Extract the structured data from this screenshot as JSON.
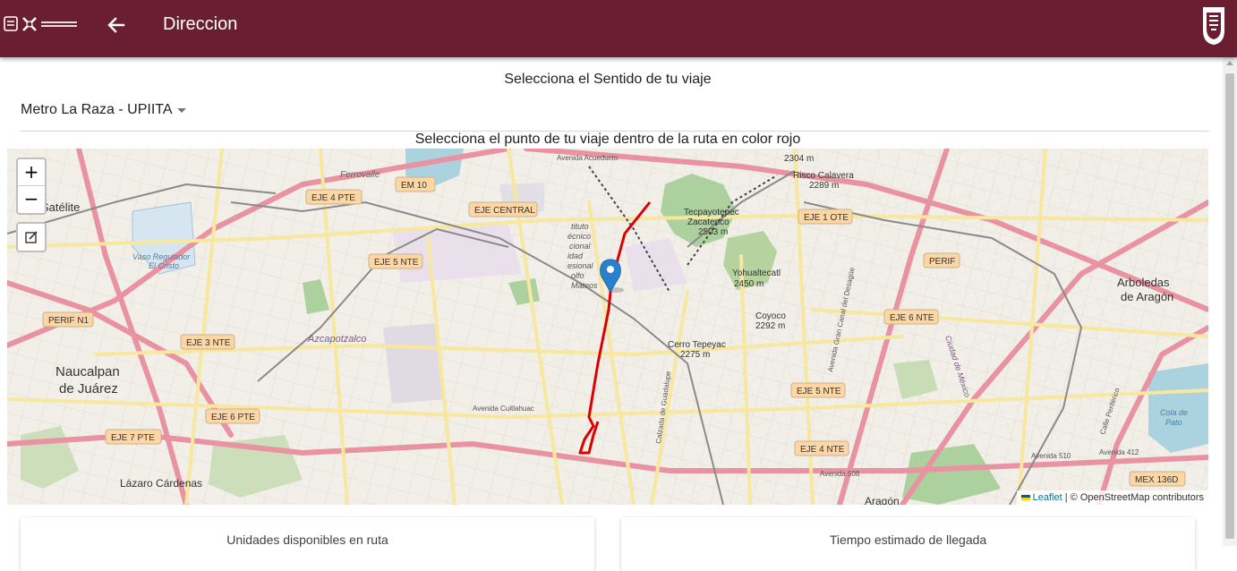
{
  "header": {
    "title": "Direccion",
    "bar_color": "#6b1d31",
    "gov_logo_icon": "gobierno-cdmx-logo",
    "back_icon": "arrow-left-icon",
    "institution_logo_icon": "ipn-logo"
  },
  "direction": {
    "heading": "Selecciona el Sentido de tu viaje",
    "selected": "Metro La Raza - UPIITA"
  },
  "map": {
    "heading": "Selecciona el punto de tu viaje dentro de la ruta en color rojo",
    "zoom_in": "+",
    "zoom_out": "−",
    "attribution": {
      "leaflet": "Leaflet",
      "separator": " | © ",
      "osm": "OpenStreetMap contributors"
    },
    "route_color": "#dd0000",
    "marker_color": "#2a81cb",
    "labels": {
      "satelite": "Satélite",
      "naucalpan1": "Naucalpan",
      "naucalpan2": "de Juárez",
      "lazaro": "Lázaro Cárdenas",
      "arboledas1": "Arboledas",
      "arboledas2": "de Aragón",
      "aragon": "Aragón",
      "azcapotzalco": "Azcapotzalco",
      "tepeyac1": "Tecpayotepec",
      "tepeyac2": "Zacatenco",
      "tepeyac3": "2503 m",
      "yohualtecatl1": "Yohualtecatl",
      "yohualtecatl2": "2450 m",
      "coyoco1": "Coyoco",
      "coyoco2": "2292 m",
      "cerro1": "Cerro Tepeyac",
      "cerro2": "2275 m",
      "risco1": "Risco Calavera",
      "risco2": "2289 m",
      "peak304": "2304 m",
      "ferrovalle": "Ferrovalle",
      "vaso1": "Vaso Regulador",
      "vaso2": "El Cristo",
      "cola1": "Cola de",
      "cola2": "Pato",
      "instituto": "Instituto Técnico Nacional Unidad Profesional Adolfo López Mateos",
      "avenida_acueducto": "Avenida Acueducto",
      "avenida_cuitlahuac": "Avenida Cuitlahuac",
      "calzada_guadalupe": "Calzada de Guadalupe",
      "gran_canal": "Avenida Gran Canal del Desagüe",
      "ciudad_mexico": "Ciudad de México",
      "avenida_510": "Avenida 510",
      "avenida_412": "Avenida 412",
      "avenida_508": "Avenida 508",
      "calle_periferico": "Calle Periférico"
    },
    "shields": {
      "eje4pte": "EJE 4 PTE",
      "em10": "EM 10",
      "ejecentral": "EJE CENTRAL",
      "eje1ote": "EJE 1 OTE",
      "eje5nte_a": "EJE 5 NTE",
      "perif": "PERIF",
      "perifn1": "PERIF N1",
      "eje3nte": "EJE 3 NTE",
      "eje6nte": "EJE 6 NTE",
      "eje5nte_b": "EJE 5 NTE",
      "eje6pte": "EJE 6 PTE",
      "eje7pte": "EJE 7 PTE",
      "eje4nte": "EJE 4 NTE",
      "mex136d": "MEX 136D"
    }
  },
  "cards": {
    "units_title": "Unidades disponibles en ruta",
    "eta_title": "Tiempo estimado de llegada"
  }
}
